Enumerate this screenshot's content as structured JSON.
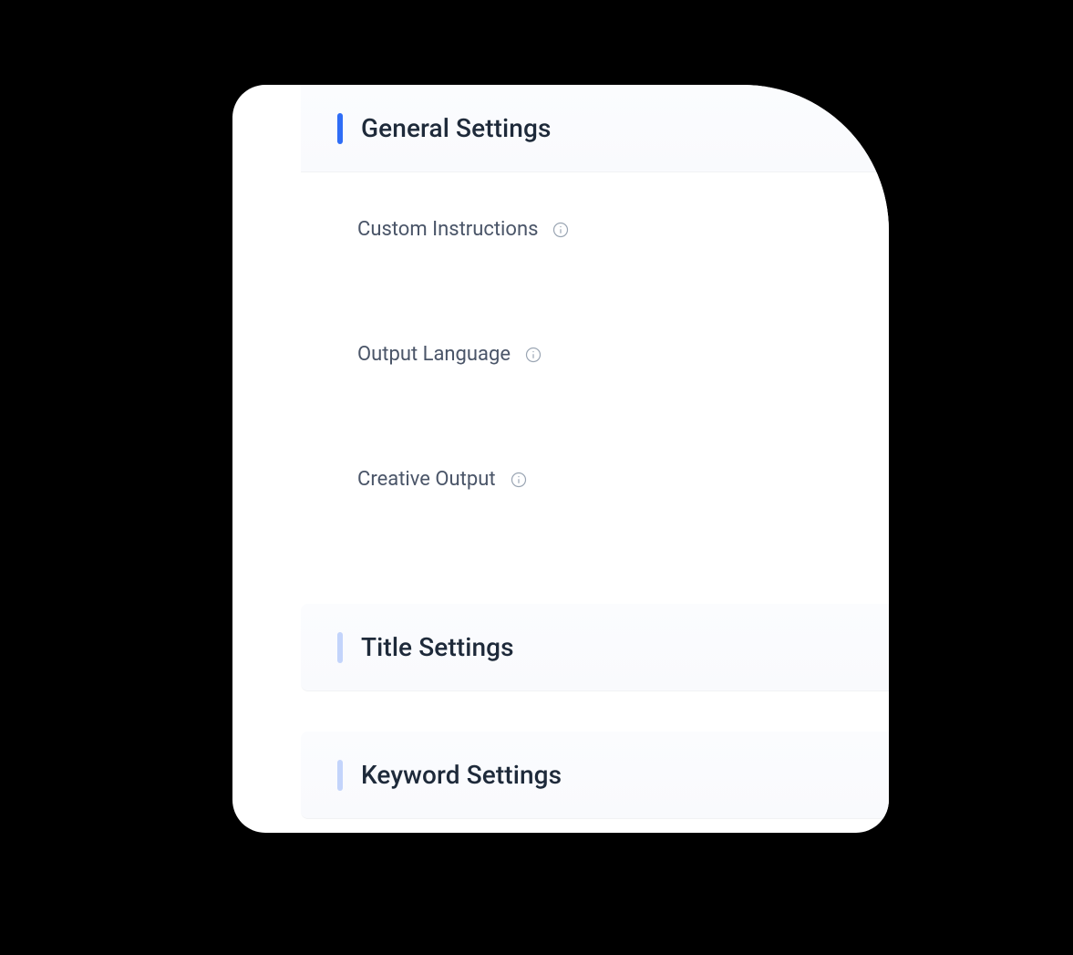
{
  "sections": {
    "general": {
      "title": "General Settings",
      "fields": {
        "custom_instructions": "Custom Instructions",
        "output_language": "Output Language",
        "creative_output": "Creative Output"
      }
    },
    "title": {
      "title": "Title Settings"
    },
    "keyword": {
      "title": "Keyword Settings"
    }
  }
}
